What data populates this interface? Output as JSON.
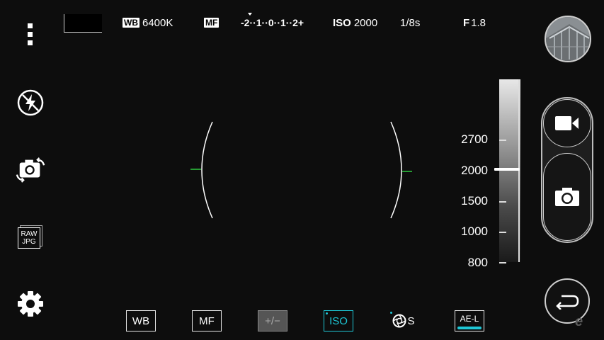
{
  "top_bar": {
    "wb_tag": "WB",
    "wb_value": "6400K",
    "focus_tag": "MF",
    "ev_scale": "-2··1··0··1··2+",
    "iso_tag": "ISO",
    "iso_value": "2000",
    "shutter": "1/8s",
    "aperture_tag": "F",
    "aperture_value": "1.8"
  },
  "left_menu": {
    "items": [
      "more-options",
      "flash-off",
      "switch-camera",
      "raw-jpg",
      "settings"
    ],
    "raw_label": "RAW",
    "jpg_label": "JPG"
  },
  "iso_slider": {
    "labels": [
      "2700",
      "2000",
      "1500",
      "1000",
      "800"
    ],
    "selected": "2000"
  },
  "bottom_bar": {
    "wb_label": "WB",
    "mf_label": "MF",
    "ev_label": "+/−",
    "iso_label": "ISO",
    "shutter_label": "S",
    "ael_label": "AE-L"
  },
  "watermark": "e",
  "colors": {
    "accent": "#1ec7d6",
    "focus_marker": "#2ecc40",
    "background": "#0d0d0d"
  }
}
